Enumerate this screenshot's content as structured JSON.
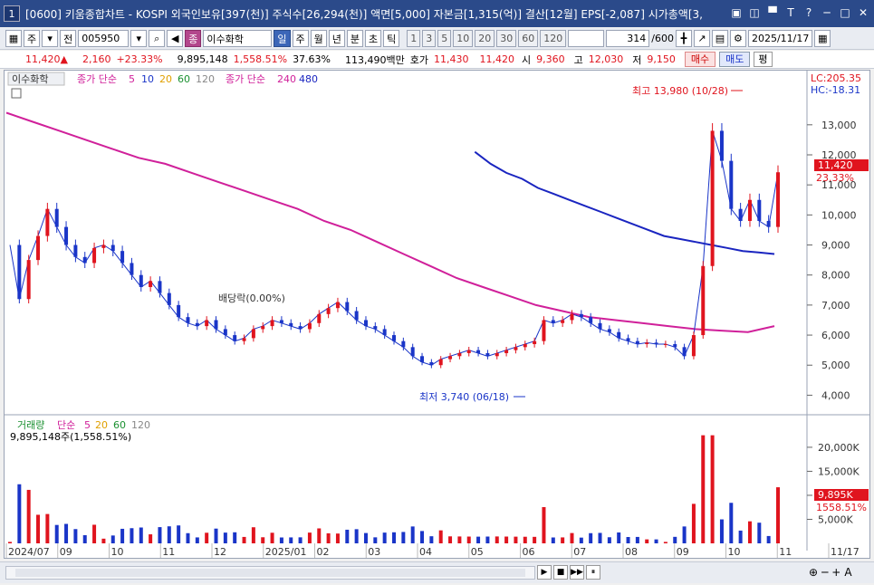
{
  "window": {
    "number": "1",
    "title": "[0600] 키움종합차트 - KOSPI 외국인보유[397(천)] 주식수[26,294(천)] 액면[5,000] 자본금[1,315(억)] 결산[12월] EPS[-2,087] 시가총액[3,",
    "controls": [
      "▣",
      "◫",
      "▀",
      "T",
      "?",
      "─",
      "□",
      "✕"
    ]
  },
  "toolbar": {
    "period_toggle": "주",
    "prev": "전",
    "code": "005950",
    "stock_badge": "종",
    "stock_name": "이수화학",
    "periods": [
      "일",
      "주",
      "월",
      "년",
      "분",
      "초",
      "틱"
    ],
    "selected_period": "일",
    "intervals": [
      "1",
      "3",
      "5",
      "10",
      "20",
      "30",
      "60",
      "120"
    ],
    "count": "314",
    "count_total": "/600",
    "date": "2025/11/17"
  },
  "infobar": {
    "price": "11,420",
    "arrow": "▲",
    "change": "2,160",
    "change_pct": "+23.33%",
    "volume": "9,895,148",
    "volume_pct": "1,558.51%",
    "turnover": "37.63%",
    "amount": "113,490백만",
    "quote_label": "호가",
    "ask": "11,430",
    "bid": "11,420",
    "open_label": "시",
    "open": "9,360",
    "high_label": "고",
    "high": "12,030",
    "low_label": "저",
    "low": "9,150",
    "buy": "매수",
    "sell": "매도",
    "eval": "평"
  },
  "chart_legend": {
    "stock": "이수화학",
    "ma_group": "종가 단순",
    "ma_values": [
      "5",
      "10",
      "20",
      "60",
      "120"
    ],
    "ma_colors": [
      "#d0209a",
      "#1a35c8",
      "#e0a000",
      "#1a9030",
      "#888888"
    ],
    "ma_group2": "종가 단순",
    "ma2_values": [
      "240",
      "480"
    ],
    "ma2_colors": [
      "#d0209a",
      "#1a25c0"
    ],
    "lc": "LC:205.35",
    "hc": "HC:-18.31",
    "annotation_high": "최고 13,980 (10/28)",
    "annotation_low": "최저 3,740 (06/18)",
    "annotation_dividend": "배당락(0.00%)",
    "price_tag": "11,420",
    "price_pct": "23.33%",
    "vol_legend_title": "거래량",
    "vol_group": "단순",
    "vol_ma": [
      "5",
      "20",
      "60",
      "120"
    ],
    "vol_ma_colors": [
      "#d0209a",
      "#e0a000",
      "#1a9030",
      "#888888"
    ],
    "vol_text": "9,895,148주(1,558.51%)",
    "vol_tag": "9,895K",
    "vol_tag_pct": "1558.51%"
  },
  "chart_data": {
    "type": "candlestick",
    "price_axis": [
      "13,000",
      "12,000",
      "11,000",
      "10,000",
      "9,000",
      "8,000",
      "7,000",
      "6,000",
      "5,000",
      "4,000"
    ],
    "price_axis_values": [
      13000,
      12000,
      11000,
      10000,
      9000,
      8000,
      7000,
      6000,
      5000,
      4000
    ],
    "volume_axis": [
      "20,000K",
      "15,000K",
      "10,000K",
      "5,000K"
    ],
    "volume_axis_values": [
      20000,
      15000,
      10000,
      5000
    ],
    "x_labels": [
      "2024/07",
      "09",
      "10",
      "11",
      "12",
      "2025/01",
      "02",
      "03",
      "04",
      "05",
      "06",
      "07",
      "08",
      "09",
      "10",
      "11",
      "11/17"
    ],
    "close_series": [
      9000,
      7200,
      8500,
      9300,
      10200,
      9600,
      9000,
      8600,
      8400,
      8900,
      9000,
      8800,
      8400,
      8000,
      7600,
      7800,
      7400,
      7000,
      6600,
      6400,
      6300,
      6500,
      6200,
      6000,
      5800,
      5900,
      6200,
      6300,
      6500,
      6400,
      6300,
      6200,
      6400,
      6700,
      6900,
      7100,
      6800,
      6500,
      6300,
      6200,
      6000,
      5800,
      5600,
      5300,
      5100,
      5000,
      5200,
      5300,
      5400,
      5500,
      5400,
      5300,
      5400,
      5500,
      5600,
      5700,
      5800,
      6500,
      6400,
      6500,
      6700,
      6600,
      6400,
      6200,
      6100,
      5900,
      5800,
      5700,
      5750,
      5700,
      5700,
      5600,
      5300,
      6000,
      8300,
      12800,
      11800,
      10200,
      9800,
      10500,
      9800,
      9600,
      11420
    ],
    "ma240_series": [
      13400,
      13100,
      12800,
      12500,
      12200,
      11900,
      11700,
      11400,
      11100,
      10800,
      10500,
      10200,
      9800,
      9500,
      9100,
      8700,
      8300,
      7900,
      7600,
      7300,
      7000,
      6800,
      6600,
      6500,
      6400,
      6300,
      6200,
      6150,
      6100,
      6300
    ],
    "ma480_series": [
      12100,
      11700,
      11400,
      11200,
      10900,
      10700,
      10500,
      10300,
      10100,
      9900,
      9700,
      9500,
      9300,
      9200,
      9100,
      9000,
      8900,
      8800,
      8750,
      8700
    ]
  },
  "bottombar": {
    "nav": [
      "▶",
      "■",
      "▶▶",
      "⏸"
    ],
    "zoom": [
      "⊕",
      "─",
      "+",
      "A"
    ]
  }
}
